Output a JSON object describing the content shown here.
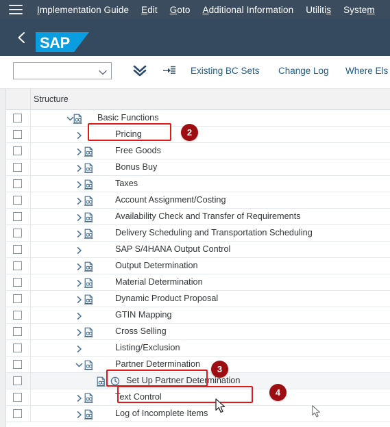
{
  "menubar": {
    "burger_icon": "hamburger-menu-icon",
    "items": [
      {
        "label": "Implementation Guide",
        "accel_index": 0
      },
      {
        "label": "Edit",
        "accel_index": 0
      },
      {
        "label": "Goto",
        "accel_index": 0
      },
      {
        "label": "Additional Information",
        "accel_index": 0
      },
      {
        "label": "Utilities",
        "accel_index": 7
      },
      {
        "label": "System",
        "accel_index": 5
      }
    ]
  },
  "shell": {
    "back_icon": "back-chevron-icon",
    "logo_text": "SAP",
    "logo_color": "#0a9ddf"
  },
  "toolbar": {
    "select_value": "",
    "select_placeholder": "",
    "expand_all_icon": "double-chevron-down-icon",
    "collapse_icon": "expand-to-list-icon",
    "buttons": [
      {
        "label": "Existing BC Sets"
      },
      {
        "label": "Change Log"
      },
      {
        "label": "Where Els"
      }
    ]
  },
  "table": {
    "column_header": "Structure",
    "rows": [
      {
        "label": "Basic Functions",
        "indent": 0,
        "twisty": "down",
        "doc": true,
        "clock": false,
        "selected": false
      },
      {
        "label": "Pricing",
        "indent": 1,
        "twisty": "right",
        "doc": false,
        "clock": false,
        "selected": false
      },
      {
        "label": "Free Goods",
        "indent": 1,
        "twisty": "right",
        "doc": true,
        "clock": false,
        "selected": false
      },
      {
        "label": "Bonus Buy",
        "indent": 1,
        "twisty": "right",
        "doc": true,
        "clock": false,
        "selected": false
      },
      {
        "label": "Taxes",
        "indent": 1,
        "twisty": "right",
        "doc": true,
        "clock": false,
        "selected": false
      },
      {
        "label": "Account Assignment/Costing",
        "indent": 1,
        "twisty": "right",
        "doc": true,
        "clock": false,
        "selected": false
      },
      {
        "label": "Availability Check and Transfer of Requirements",
        "indent": 1,
        "twisty": "right",
        "doc": true,
        "clock": false,
        "selected": false
      },
      {
        "label": "Delivery Scheduling and Transportation Scheduling",
        "indent": 1,
        "twisty": "right",
        "doc": true,
        "clock": false,
        "selected": false
      },
      {
        "label": "SAP S/4HANA Output Control",
        "indent": 1,
        "twisty": "right",
        "doc": false,
        "clock": false,
        "selected": false
      },
      {
        "label": "Output Determination",
        "indent": 1,
        "twisty": "right",
        "doc": true,
        "clock": false,
        "selected": false
      },
      {
        "label": "Material Determination",
        "indent": 1,
        "twisty": "right",
        "doc": true,
        "clock": false,
        "selected": false
      },
      {
        "label": "Dynamic Product Proposal",
        "indent": 1,
        "twisty": "right",
        "doc": true,
        "clock": false,
        "selected": false
      },
      {
        "label": "GTIN Mapping",
        "indent": 1,
        "twisty": "right",
        "doc": false,
        "clock": false,
        "selected": false
      },
      {
        "label": "Cross Selling",
        "indent": 1,
        "twisty": "right",
        "doc": true,
        "clock": false,
        "selected": false
      },
      {
        "label": "Listing/Exclusion",
        "indent": 1,
        "twisty": "right",
        "doc": false,
        "clock": false,
        "selected": false
      },
      {
        "label": "Partner Determination",
        "indent": 1,
        "twisty": "down",
        "doc": true,
        "clock": false,
        "selected": false
      },
      {
        "label": "Set Up Partner Determination",
        "indent": 2,
        "twisty": "none",
        "doc": true,
        "clock": true,
        "selected": true
      },
      {
        "label": "Text Control",
        "indent": 1,
        "twisty": "right",
        "doc": true,
        "clock": false,
        "selected": false
      },
      {
        "label": "Log of Incomplete Items",
        "indent": 1,
        "twisty": "right",
        "doc": true,
        "clock": false,
        "selected": false
      }
    ]
  },
  "annotations": {
    "badge_color": "#9c0e12",
    "highlight_color": "#e01a1a",
    "badges": [
      {
        "number": "2",
        "target": "Basic Functions"
      },
      {
        "number": "3",
        "target": "Partner Determination"
      },
      {
        "number": "4",
        "target": "Set Up Partner Determination"
      }
    ],
    "cursor_icon": "mouse-pointer-icon"
  }
}
